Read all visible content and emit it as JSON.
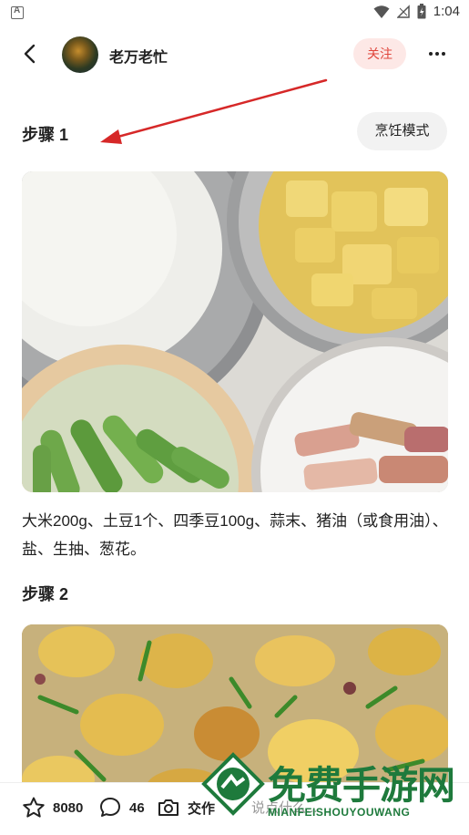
{
  "status_bar": {
    "time": "1:04"
  },
  "header": {
    "username": "老万老忙",
    "follow_label": "关注"
  },
  "step1": {
    "title": "步骤 1",
    "cook_mode_label": "烹饪模式",
    "text": "大米200g、土豆1个、四季豆100g、蒜末、猪油（或食用油）、盐、生抽、葱花。"
  },
  "step2": {
    "title": "步骤 2"
  },
  "bottom_bar": {
    "favorites": "8080",
    "comments": "46",
    "upload_label": "交作",
    "comment_placeholder": "说点什么..."
  },
  "watermark": {
    "title": "免费手游网",
    "subtitle": "MIANFEISHOUYOUWANG"
  },
  "colors": {
    "accent": "#e0463c",
    "follow_bg": "#fde8e6",
    "watermark": "#1e7a3c",
    "arrow": "#d62828"
  }
}
